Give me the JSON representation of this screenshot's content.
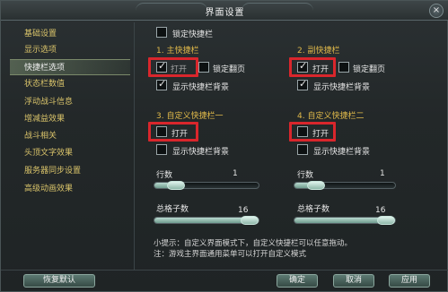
{
  "window": {
    "title": "界面设置",
    "close_glyph": "×"
  },
  "sidebar": {
    "items": [
      {
        "label": "基础设置"
      },
      {
        "label": "显示选项"
      },
      {
        "label": "快捷栏选项",
        "active": true
      },
      {
        "label": "状态栏数值"
      },
      {
        "label": "浮动战斗信息"
      },
      {
        "label": "增减益效果"
      },
      {
        "label": "战斗相关"
      },
      {
        "label": "头顶文字效果"
      },
      {
        "label": "服务器同步设置"
      },
      {
        "label": "高级动画效果"
      }
    ]
  },
  "lock_bar": {
    "label": "锁定快捷栏",
    "checked": false
  },
  "main_bar": {
    "title": "1. 主快捷栏",
    "open_label": "打开",
    "open_checked": true,
    "open_disabled": true,
    "lock_flip_label": "锁定翻页",
    "lock_flip_checked": false,
    "bg_label": "显示快捷栏背景",
    "bg_checked": true
  },
  "sub_bar": {
    "title": "2. 副快捷栏",
    "open_label": "打开",
    "open_checked": true,
    "lock_flip_label": "锁定翻页",
    "lock_flip_checked": false,
    "bg_label": "显示快捷栏背景",
    "bg_checked": true
  },
  "custom_bar_1": {
    "title": "3. 自定义快捷栏一",
    "open_label": "打开",
    "open_checked": false,
    "bg_label": "显示快捷栏背景",
    "bg_checked": false,
    "rows_label": "行数",
    "rows_value": "1",
    "rows_fraction": 0.15,
    "cells_label": "总格子数",
    "cells_value": "16",
    "cells_fraction": 1.0
  },
  "custom_bar_2": {
    "title": "4. 自定义快捷栏二",
    "open_label": "打开",
    "open_checked": false,
    "bg_label": "显示快捷栏背景",
    "bg_checked": false,
    "rows_label": "行数",
    "rows_value": "1",
    "rows_fraction": 0.15,
    "cells_label": "总格子数",
    "cells_value": "16",
    "cells_fraction": 1.0
  },
  "hints": {
    "line1": "小提示：自定义界面模式下，自定义快捷栏可以任意拖动。",
    "line2": "注：游戏主界面通用菜单可以打开自定义模式"
  },
  "buttons": {
    "restore": "恢复默认",
    "ok": "确定",
    "cancel": "取消",
    "apply": "应用"
  },
  "colors": {
    "highlight": "#d9262c",
    "section_title": "#e0b94a",
    "sidebar_text": "#d9c36a"
  }
}
